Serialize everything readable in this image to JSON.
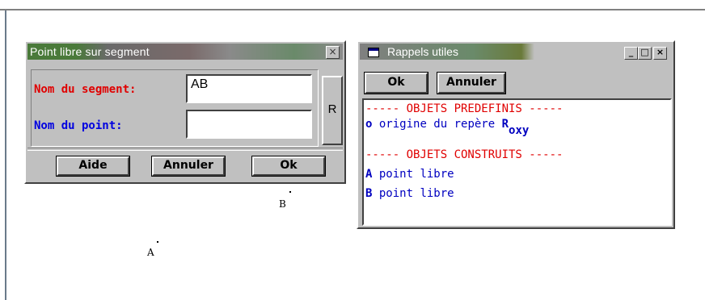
{
  "dialog_point": {
    "title": "Point libre sur segment",
    "close": "×",
    "label_segment": "Nom du segment:",
    "value_segment": "AB",
    "label_point": "Nom du point:",
    "value_point": "",
    "r_button": "R",
    "btn_aide": "Aide",
    "btn_annuler": "Annuler",
    "btn_ok": "Ok"
  },
  "dialog_rappels": {
    "title": "Rappels utiles",
    "min": "_",
    "max": "□",
    "close": "×",
    "btn_ok": "Ok",
    "btn_annuler": "Annuler",
    "header_predef": "----- OBJETS PREDEFINIS -----",
    "origin_letter": "o",
    "origin_text": " origine du repère ",
    "origin_R": "R",
    "origin_sub": "oxy",
    "header_construits": "----- OBJETS CONSTRUITS -----",
    "items": [
      {
        "letter": "A",
        "text": " point libre"
      },
      {
        "letter": "B",
        "text": " point libre"
      }
    ]
  },
  "canvas": {
    "point_a": "A",
    "point_b": "B"
  }
}
